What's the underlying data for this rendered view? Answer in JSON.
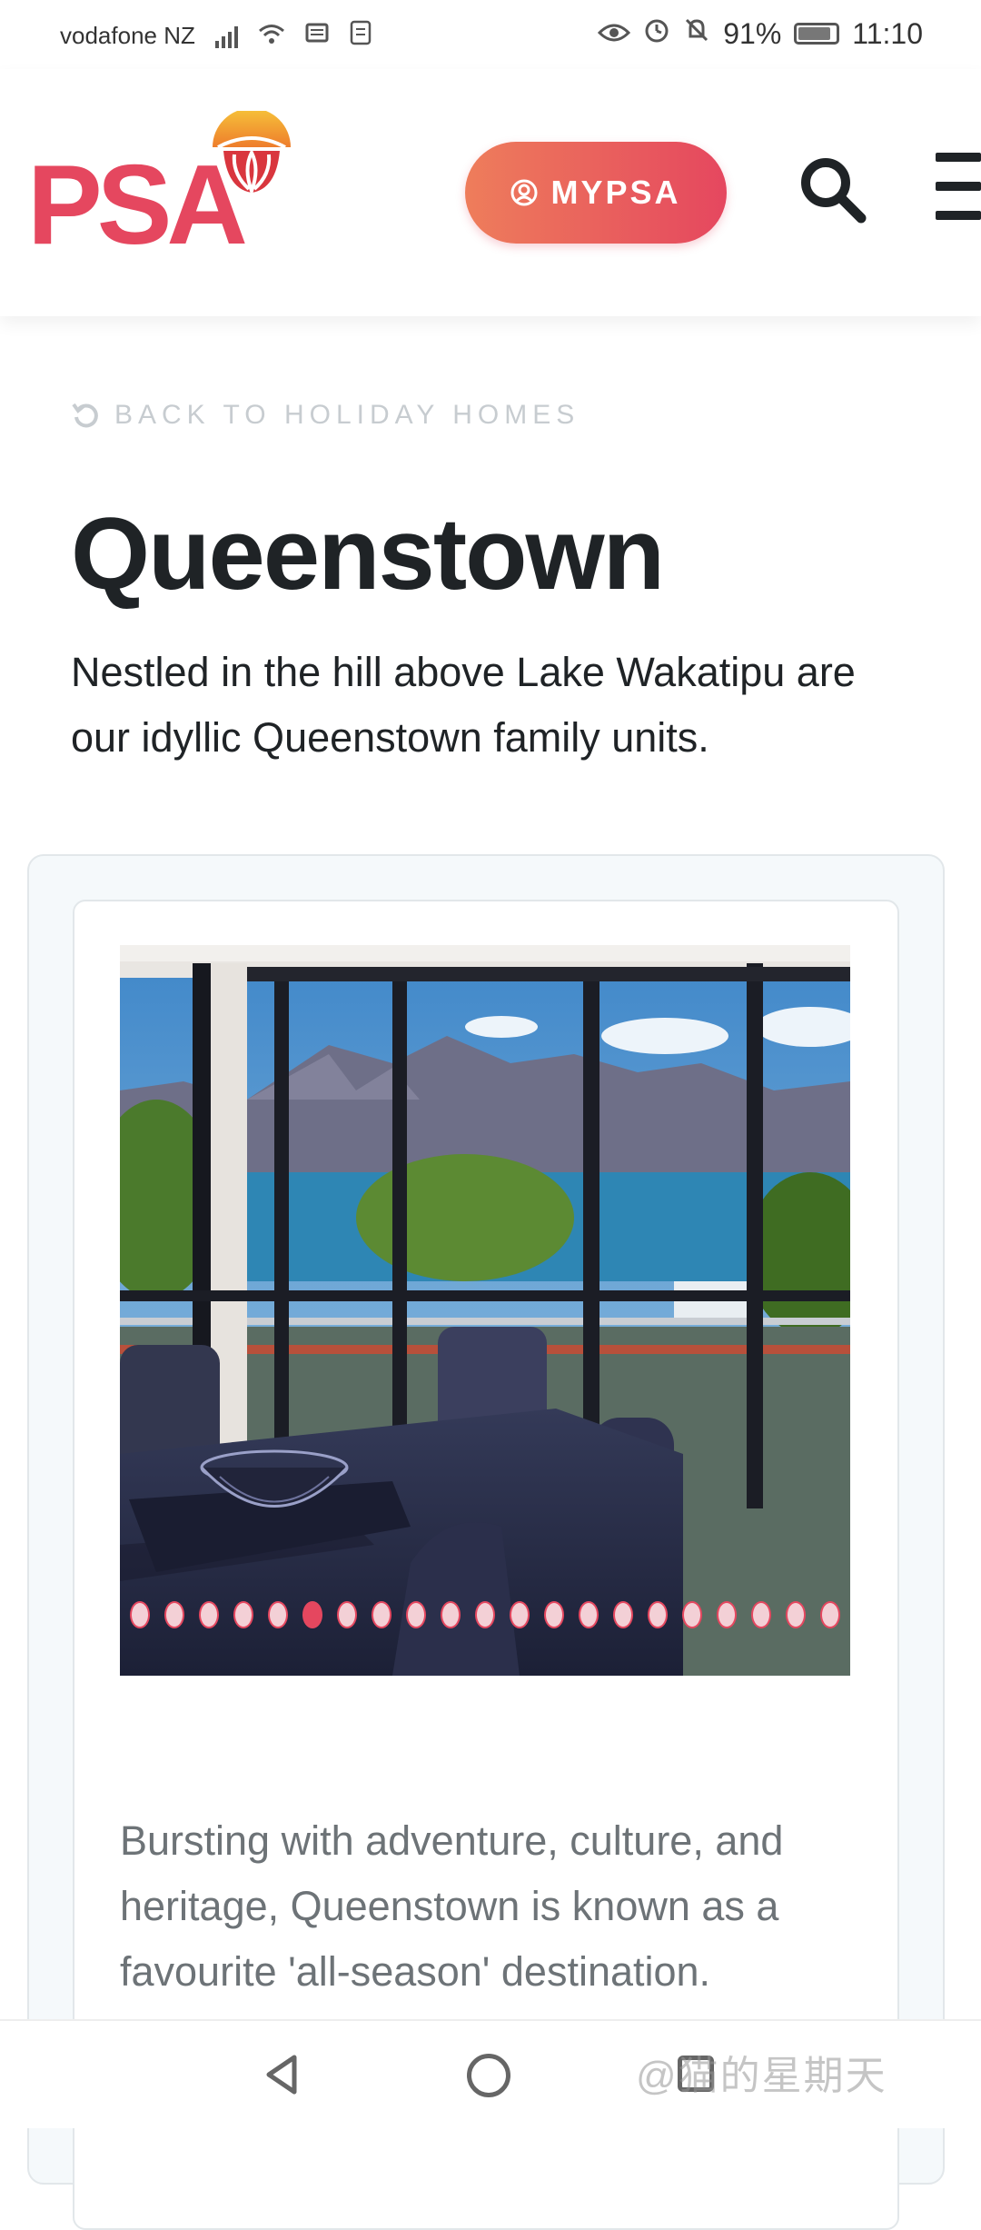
{
  "status": {
    "carrier": "vodafone NZ",
    "battery": "91%",
    "time": "11:10"
  },
  "header": {
    "logo": "PSA",
    "mypsa_label": "MYPSA"
  },
  "page": {
    "back_link": "BACK TO HOLIDAY HOMES",
    "title": "Queenstown",
    "intro": "Nestled in the hill above Lake Wakatipu are our idyllic Queenstown family units.",
    "description": "Bursting with adventure, culture, and heritage, Queenstown is known as a favourite 'all-season' destination."
  },
  "carousel": {
    "total": 21,
    "active_index": 5
  },
  "watermark": "@猫的星期天",
  "colors": {
    "brand": "#e5475f",
    "button_gradient_start": "#ee7d5b"
  }
}
